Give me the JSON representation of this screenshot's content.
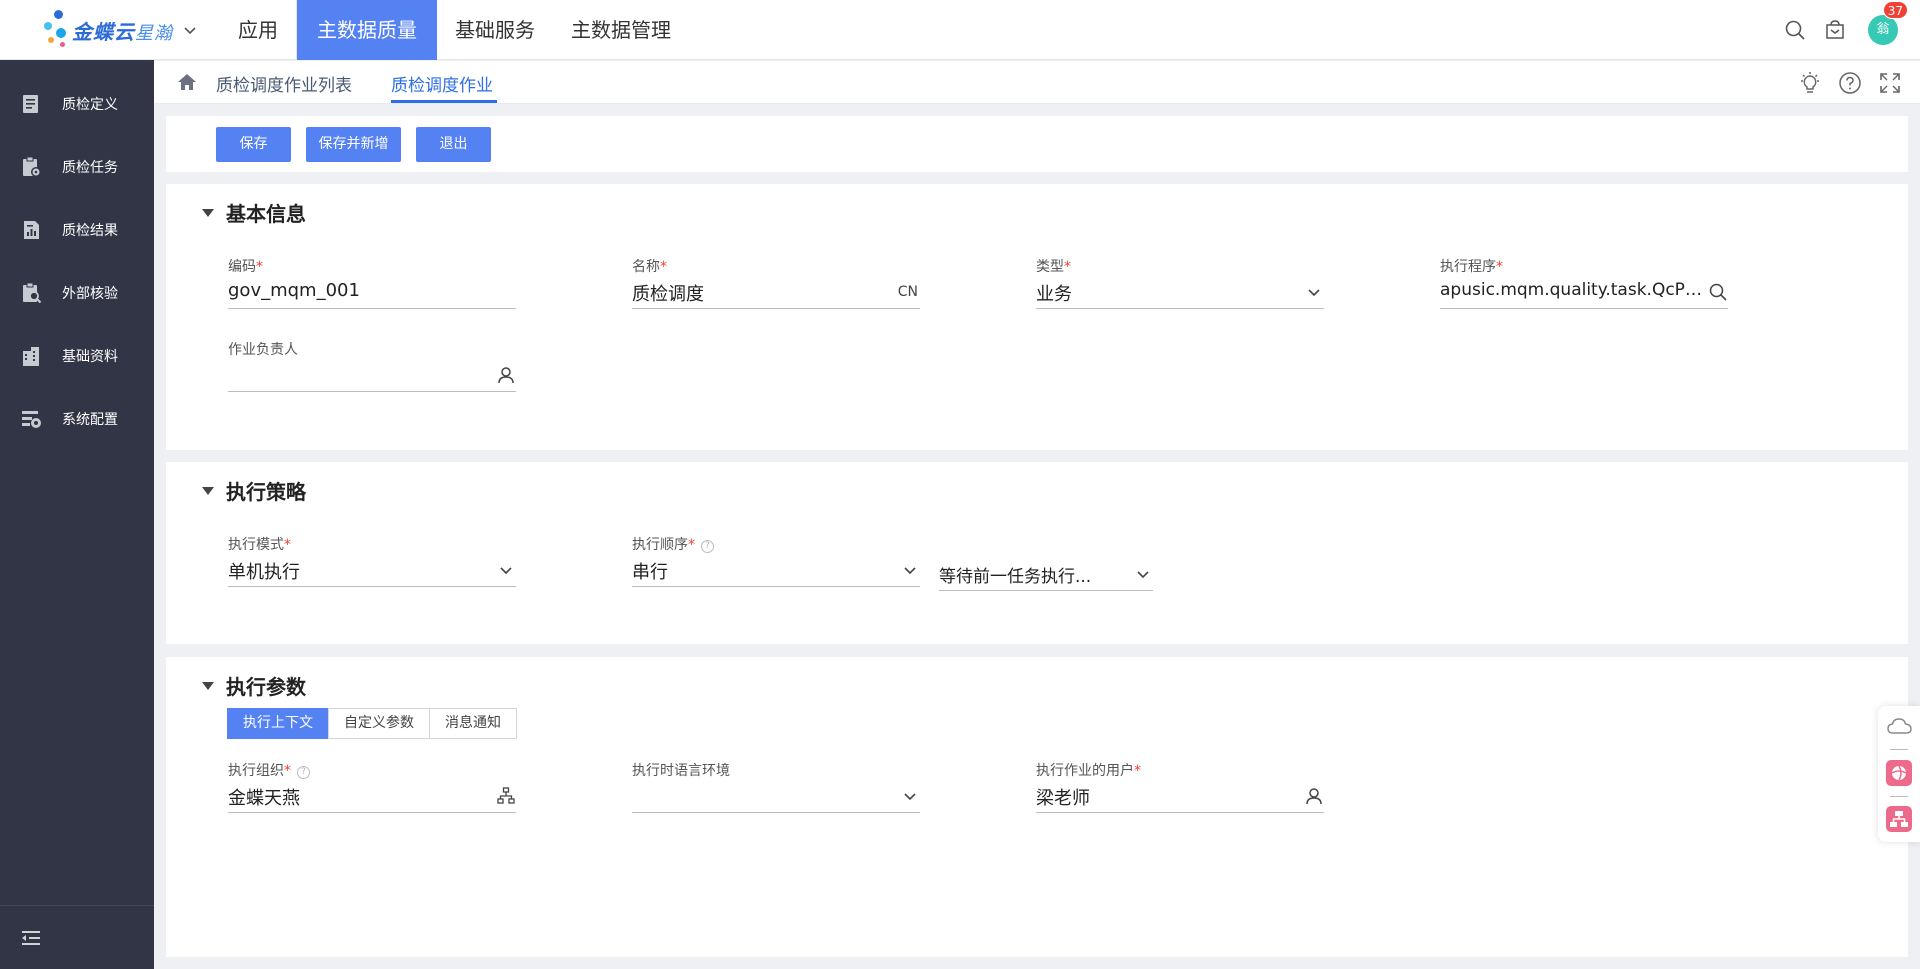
{
  "app": {
    "logo_main": "金蝶云",
    "logo_sub": "星瀚",
    "nav": [
      "应用",
      "主数据质量",
      "基础服务",
      "主数据管理"
    ],
    "active_nav_index": 1,
    "avatar_text": "翁",
    "notification_count": "37",
    "accent_color": "#5582f3"
  },
  "sidebar": {
    "items": [
      {
        "label": "质检定义",
        "icon": "document-icon"
      },
      {
        "label": "质检任务",
        "icon": "clipboard-gear-icon"
      },
      {
        "label": "质检结果",
        "icon": "report-icon"
      },
      {
        "label": "外部核验",
        "icon": "clipboard-search-icon"
      },
      {
        "label": "基础资料",
        "icon": "buildings-icon"
      },
      {
        "label": "系统配置",
        "icon": "settings-list-icon"
      }
    ]
  },
  "breadcrumb": {
    "tabs": [
      "质检调度作业列表",
      "质检调度作业"
    ],
    "active_index": 1
  },
  "toolbar": {
    "save": "保存",
    "save_new": "保存并新增",
    "exit": "退出"
  },
  "basic_info": {
    "title": "基本信息",
    "code": {
      "label": "编码",
      "value": "gov_mqm_001"
    },
    "name": {
      "label": "名称",
      "value": "质检调度",
      "suffix": "CN"
    },
    "type": {
      "label": "类型",
      "value": "业务"
    },
    "program": {
      "label": "执行程序",
      "value": "apusic.mqm.quality.task.QcPla..."
    },
    "owner": {
      "label": "作业负责人",
      "value": ""
    }
  },
  "strategy": {
    "title": "执行策略",
    "mode": {
      "label": "执行模式",
      "value": "单机执行"
    },
    "order": {
      "label": "执行顺序",
      "value": "串行"
    },
    "wait": {
      "value": "等待前一任务执行..."
    }
  },
  "params": {
    "title": "执行参数",
    "tabs": [
      "执行上下文",
      "自定义参数",
      "消息通知"
    ],
    "active_tab": 0,
    "org": {
      "label": "执行组织",
      "value": "金蝶天燕"
    },
    "locale": {
      "label": "执行时语言环境",
      "value": ""
    },
    "user": {
      "label": "执行作业的用户",
      "value": "梁老师"
    }
  }
}
